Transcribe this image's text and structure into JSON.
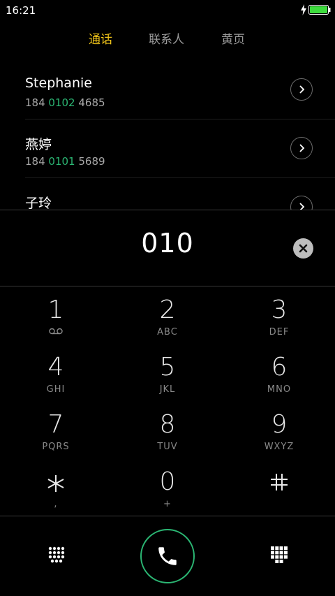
{
  "status": {
    "time": "16:21",
    "battery_color": "#3ddc3d"
  },
  "tabs": [
    {
      "label": "通话",
      "active": true
    },
    {
      "label": "联系人",
      "active": false
    },
    {
      "label": "黄页",
      "active": false
    }
  ],
  "contacts": [
    {
      "name": "Stephanie",
      "number_pre": "184 ",
      "number_match": "0102",
      "number_post": " 4685"
    },
    {
      "name": "燕婷",
      "number_pre": "184 ",
      "number_match": "0101",
      "number_post": " 5689"
    },
    {
      "name": "子玲",
      "number_pre": "",
      "number_match": "",
      "number_post": ""
    }
  ],
  "dial_input": "010",
  "keypad": [
    {
      "digit": "1",
      "letters": ""
    },
    {
      "digit": "2",
      "letters": "ABC"
    },
    {
      "digit": "3",
      "letters": "DEF"
    },
    {
      "digit": "4",
      "letters": "GHI"
    },
    {
      "digit": "5",
      "letters": "JKL"
    },
    {
      "digit": "6",
      "letters": "MNO"
    },
    {
      "digit": "7",
      "letters": "PQRS"
    },
    {
      "digit": "8",
      "letters": "TUV"
    },
    {
      "digit": "9",
      "letters": "WXYZ"
    },
    {
      "digit": "*",
      "letters": ","
    },
    {
      "digit": "0",
      "letters": "+"
    },
    {
      "digit": "#",
      "letters": ""
    }
  ],
  "icons": {
    "charge": "charging-bolt-icon",
    "battery": "battery-icon",
    "detail": "chevron-right-icon",
    "clear": "clear-x-icon",
    "voicemail": "voicemail-icon",
    "call": "phone-icon",
    "grid_left": "dots-grid-icon",
    "grid_right": "dialpad-icon"
  },
  "colors": {
    "accent": "#f0c419",
    "match": "#2bb673",
    "call_ring": "#2bb673"
  }
}
